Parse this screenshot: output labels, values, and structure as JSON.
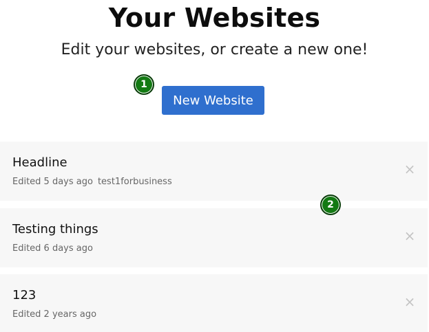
{
  "header": {
    "title": "Your Websites",
    "subtitle": "Edit your websites, or create a new one!"
  },
  "actions": {
    "new_website_label": "New Website"
  },
  "markers": [
    "1",
    "2"
  ],
  "sites": [
    {
      "name": "Headline",
      "edited": "Edited 5 days ago",
      "owner": "test1forbusiness",
      "delete_icon": "close-icon"
    },
    {
      "name": "Testing things",
      "edited": "Edited 6 days ago",
      "owner": "",
      "delete_icon": "close-icon"
    },
    {
      "name": "123",
      "edited": "Edited 2 years ago",
      "owner": "",
      "delete_icon": "close-icon"
    }
  ],
  "colors": {
    "primary_button": "#2f6fce",
    "card_background": "#f7f7f7",
    "marker_green": "#137a13"
  }
}
